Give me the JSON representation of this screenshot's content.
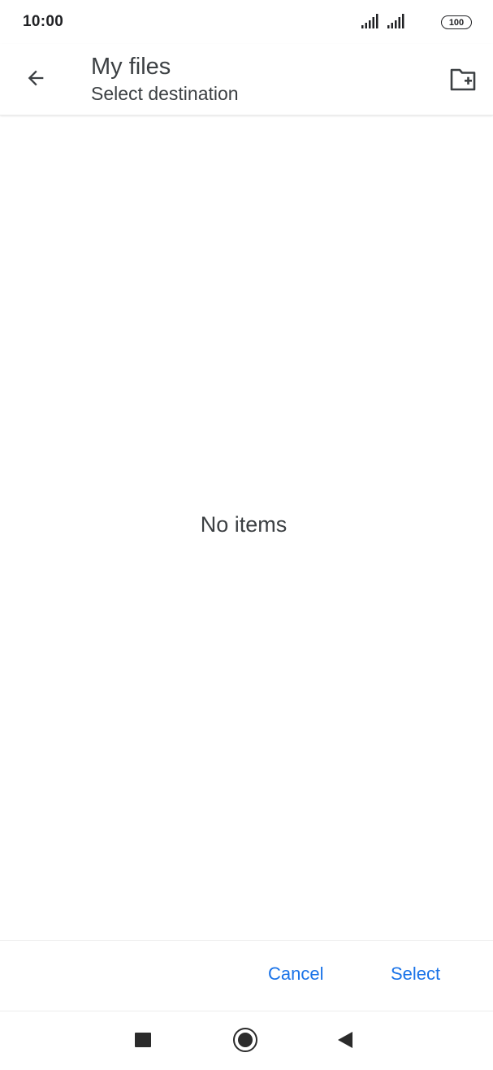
{
  "status_bar": {
    "time": "10:00",
    "battery_level": "100",
    "icons": [
      "signal-icon",
      "signal-icon",
      "battery-icon"
    ]
  },
  "app_bar": {
    "title": "My files",
    "subtitle": "Select destination",
    "back_icon": "arrow-back-icon",
    "action_icon": "create-new-folder-icon"
  },
  "content": {
    "empty_message": "No items"
  },
  "actions": {
    "cancel_label": "Cancel",
    "select_label": "Select",
    "accent_color": "#1a73e8"
  },
  "nav_bar": {
    "icons": [
      "recents-square-icon",
      "home-circle-icon",
      "back-triangle-icon"
    ]
  }
}
